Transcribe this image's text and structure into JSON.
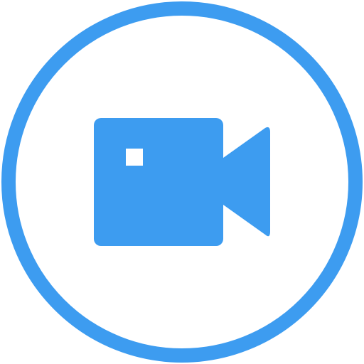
{
  "icon": {
    "name": "video-camera-icon",
    "button_name": "video-call-button"
  },
  "colors": {
    "accent": "#3d9cf0",
    "background": "#ffffff",
    "highlight": "#ffffff"
  }
}
